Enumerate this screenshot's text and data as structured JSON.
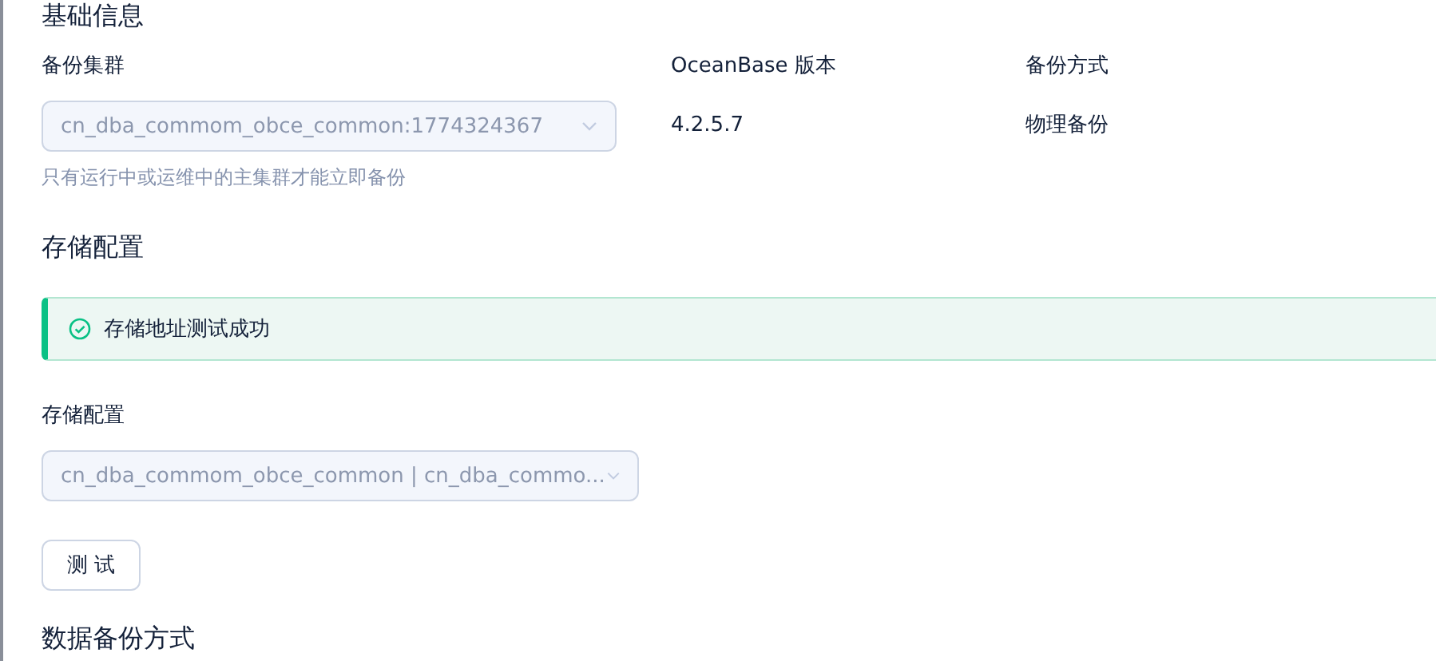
{
  "basic_info": {
    "title": "基础信息",
    "fields": [
      {
        "label": "备份集群",
        "kind": "select",
        "value": "cn_dba_commom_obce_common:1774324367",
        "disabled": true,
        "hint": "只有运行中或运维中的主集群才能立即备份"
      },
      {
        "label": "OceanBase 版本",
        "kind": "text",
        "value": "4.2.5.7"
      },
      {
        "label": "备份方式",
        "kind": "text",
        "value": "物理备份"
      }
    ]
  },
  "storage": {
    "title": "存储配置",
    "alert": {
      "message": "存储地址测试成功"
    },
    "field": {
      "label": "存储配置",
      "value": "cn_dba_commom_obce_common | cn_dba_commo...",
      "disabled": true
    },
    "test_button": "测 试"
  },
  "data_backup": {
    "title": "数据备份方式"
  }
}
